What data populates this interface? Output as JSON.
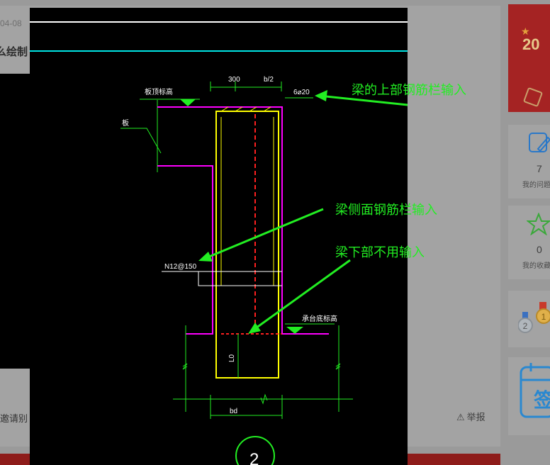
{
  "background_page": {
    "date_fragment": "04-08",
    "title_fragment": "么绘制",
    "invite_fragment": "邀请别",
    "report_label": "举报"
  },
  "sidebar": {
    "banner_year_fragment": "20",
    "stats": [
      {
        "count": "7",
        "label": "我的问题"
      },
      {
        "count": "0",
        "label": "我的收藏"
      }
    ],
    "sign_label": "签"
  },
  "drawing": {
    "dim_width": "300",
    "dim_top_right": "b/2",
    "rebar_top": "6⌀20",
    "label_top_left": "板顶标高",
    "label_side_left": "板",
    "rebar_side": "N12@150",
    "label_bottom_right": "承台底标高",
    "dim_depth": "L0",
    "dim_bottom": "bd",
    "section_number": "2"
  },
  "annotations": {
    "top_rebar": "梁的上部钢筋栏输入",
    "side_rebar": "梁侧面钢筋栏输入",
    "bottom_rebar": "梁下部不用输入"
  },
  "colors": {
    "annotation": "#22ee22",
    "cad_background": "#000000",
    "magenta_line": "#ff00ff",
    "yellow_line": "#ffff00",
    "cyan_line": "#00e5e5",
    "red_dash": "#ff2020"
  }
}
